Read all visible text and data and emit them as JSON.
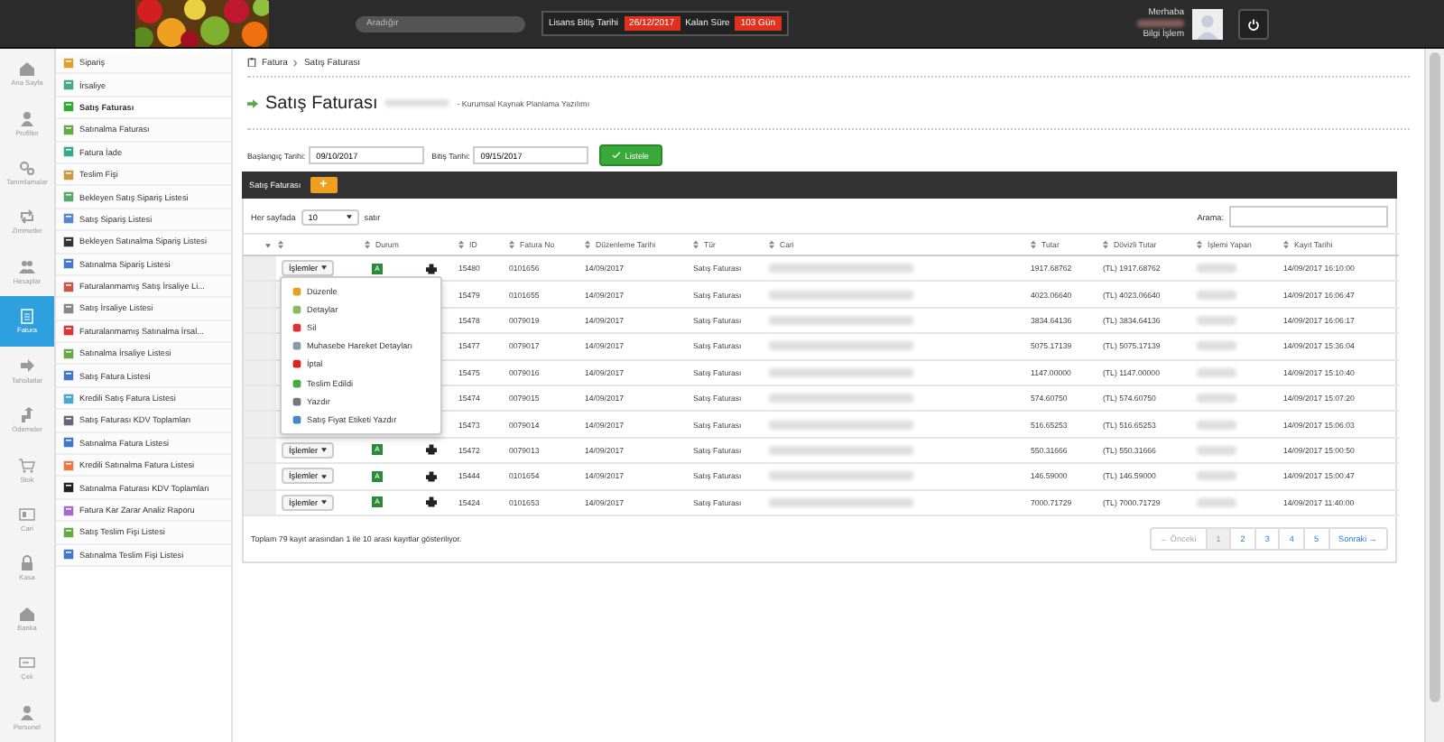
{
  "topbar": {
    "search": {
      "placeholder": "Aradığır"
    },
    "license": {
      "end_label": "Lisans Bitiş Tarihi",
      "end_date": "26/12/2017",
      "remaining_label": "Kalan Süre",
      "remaining": "103 Gün"
    },
    "user": {
      "greeting": "Merhaba",
      "department": "Bilgi İşlem"
    }
  },
  "modules": [
    {
      "label": "Ana Sayfa",
      "selected": false
    },
    {
      "label": "Profiller",
      "selected": false
    },
    {
      "label": "Tanımlamalar",
      "selected": false
    },
    {
      "label": "Zimmetler",
      "selected": false
    },
    {
      "label": "Hesaplar",
      "selected": false
    },
    {
      "label": "Fatura",
      "selected": true
    },
    {
      "label": "Tahsilatlar",
      "selected": false
    },
    {
      "label": "Ödemeler",
      "selected": false
    },
    {
      "label": "Stok",
      "selected": false
    },
    {
      "label": "Cari",
      "selected": false
    },
    {
      "label": "Kasa",
      "selected": false
    },
    {
      "label": "Banka",
      "selected": false
    },
    {
      "label": "Çek",
      "selected": false
    },
    {
      "label": "Personel",
      "selected": false
    }
  ],
  "menu": [
    {
      "label": "Sipariş",
      "selected": false
    },
    {
      "label": "İrsaliye",
      "selected": false
    },
    {
      "label": "Satış Faturası",
      "selected": true
    },
    {
      "label": "Satınalma Faturası",
      "selected": false
    },
    {
      "label": "Fatura İade",
      "selected": false
    },
    {
      "label": "Teslim Fişi",
      "selected": false
    },
    {
      "label": "Bekleyen Satış Sipariş Listesi",
      "selected": false
    },
    {
      "label": "Satış Sipariş Listesi",
      "selected": false
    },
    {
      "label": "Bekleyen Satınalma Sipariş Listesi",
      "selected": false
    },
    {
      "label": "Satınalma Sipariş Listesi",
      "selected": false
    },
    {
      "label": "Faturalanmamış Satış İrsaliye Li...",
      "selected": false
    },
    {
      "label": "Satış İrsaliye Listesi",
      "selected": false
    },
    {
      "label": "Faturalanmamış Satınalma İrsal...",
      "selected": false
    },
    {
      "label": "Satınalma İrsaliye Listesi",
      "selected": false
    },
    {
      "label": "Satış Fatura Listesi",
      "selected": false
    },
    {
      "label": "Kredili Satış Fatura Listesi",
      "selected": false
    },
    {
      "label": "Satış Faturası KDV Toplamları",
      "selected": false
    },
    {
      "label": "Satınalma Fatura Listesi",
      "selected": false
    },
    {
      "label": "Kredili Satınalma Fatura Listesi",
      "selected": false
    },
    {
      "label": "Satınalma Faturası KDV Toplamları",
      "selected": false
    },
    {
      "label": "Fatura Kar Zarar Analiz Raporu",
      "selected": false
    },
    {
      "label": "Satış Teslim Fişi Listesi",
      "selected": false
    },
    {
      "label": "Satınalma Teslim Fişi Listesi",
      "selected": false
    }
  ],
  "breadcrumb": [
    "Fatura",
    "Satış Faturası"
  ],
  "page": {
    "title": "Satış Faturası",
    "subtitle": "- Kurumsal Kaynak Planlama Yazılımı"
  },
  "filter": {
    "start_label": "Başlangıç Tarihi:",
    "start": "09/10/2017",
    "end_label": "Bitiş Tarihi:",
    "end": "09/15/2017",
    "button": "Listele"
  },
  "panel": {
    "title": "Satış Faturası",
    "add": "+",
    "per_page_before": "Her sayfada",
    "per_page": "10",
    "per_page_after": "satır",
    "search_label": "Arama:"
  },
  "table": {
    "columns": [
      "Durum",
      "ID",
      "Fatura No",
      "Düzenleme Tarihi",
      "Tür",
      "Cari",
      "Tutar",
      "Dövizli Tutar",
      "İşlemi Yapan",
      "Kayıt Tarihi"
    ],
    "rows": [
      {
        "action": "İşlemler",
        "status": "A",
        "id": "15480",
        "no": "0101656",
        "date": "14/09/2017",
        "type": "Satış Faturası",
        "amount": "1917.68762",
        "fx": "(TL) 1917.68762",
        "created": "14/09/2017 16:10:00"
      },
      {
        "id": "15479",
        "no": "0101655",
        "date": "14/09/2017",
        "type": "Satış Faturası",
        "amount": "4023.06640",
        "fx": "(TL) 4023.06640",
        "created": "14/09/2017 16:06:47"
      },
      {
        "id": "15478",
        "no": "0079019",
        "date": "14/09/2017",
        "type": "Satış Faturası",
        "amount": "3834.64136",
        "fx": "(TL) 3834.64136",
        "created": "14/09/2017 16:06:17"
      },
      {
        "id": "15477",
        "no": "0079017",
        "date": "14/09/2017",
        "type": "Satış Faturası",
        "amount": "5075.17139",
        "fx": "(TL) 5075.17139",
        "created": "14/09/2017 15:36:04"
      },
      {
        "id": "15475",
        "no": "0079016",
        "date": "14/09/2017",
        "type": "Satış Faturası",
        "amount": "1147.00000",
        "fx": "(TL) 1147.00000",
        "created": "14/09/2017 15:10:40"
      },
      {
        "id": "15474",
        "no": "0079015",
        "date": "14/09/2017",
        "type": "Satış Faturası",
        "amount": "574.60750",
        "fx": "(TL) 574.60750",
        "created": "14/09/2017 15:07:20"
      },
      {
        "id": "15473",
        "no": "0079014",
        "date": "14/09/2017",
        "type": "Satış Faturası",
        "amount": "516.65253",
        "fx": "(TL) 516.65253",
        "created": "14/09/2017 15:06:03"
      },
      {
        "action": "İşlemler",
        "status": "A",
        "id": "15472",
        "no": "0079013",
        "date": "14/09/2017",
        "type": "Satış Faturası",
        "amount": "550.31666",
        "fx": "(TL) 550.31666",
        "created": "14/09/2017 15:00:50"
      },
      {
        "action": "İşlemler",
        "status": "A",
        "id": "15444",
        "no": "0101654",
        "date": "14/09/2017",
        "type": "Satış Faturası",
        "amount": "146.59000",
        "fx": "(TL) 146.59000",
        "created": "14/09/2017 15:00:47"
      },
      {
        "action": "İşlemler",
        "status": "A",
        "id": "15424",
        "no": "0101653",
        "date": "14/09/2017",
        "type": "Satış Faturası",
        "amount": "7000.71729",
        "fx": "(TL) 7000.71729",
        "created": "14/09/2017 11:40:00"
      }
    ]
  },
  "actions_menu": [
    "Düzenle",
    "Detaylar",
    "Sil",
    "Muhasebe Hareket Detayları",
    "İptal",
    "Teslim Edildi",
    "Yazdır",
    "Satış Fiyat Etiketi Yazdır"
  ],
  "footer": "Toplam 79 kayıt arasından 1 ile 10 arası kayıtlar gösteriliyor.",
  "pagination": {
    "prev": "← Önceki",
    "pages": [
      {
        "label": "1",
        "selected": true
      },
      {
        "label": "2",
        "selected": false
      },
      {
        "label": "3",
        "selected": false
      },
      {
        "label": "4",
        "selected": false
      },
      {
        "label": "5",
        "selected": false
      }
    ],
    "next": "Sonraki →"
  }
}
